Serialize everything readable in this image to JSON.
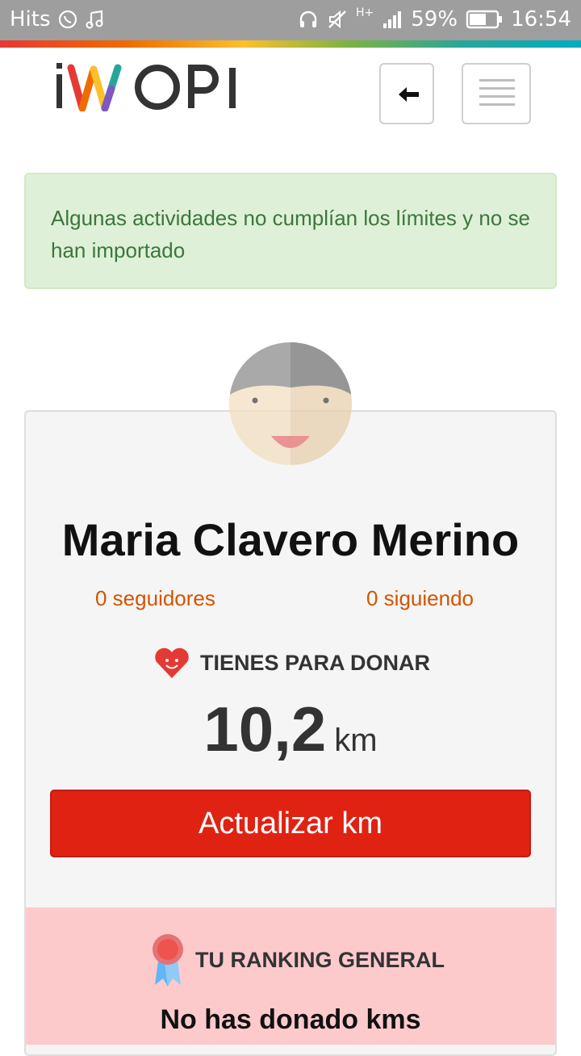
{
  "status_bar": {
    "carrier": "Hits",
    "battery": "59%",
    "time": "16:54",
    "network": "H+",
    "icons": [
      "whatsapp-icon",
      "music-icon",
      "headphones-icon",
      "mute-icon",
      "signal-icon",
      "battery-icon"
    ]
  },
  "header": {
    "logo_text": "iWOPI",
    "back_icon": "arrow-left-icon",
    "menu_icon": "hamburger-icon"
  },
  "alert": {
    "message": "Algunas actividades no cumplían los límites y no se han importado"
  },
  "profile": {
    "name": "Maria Clavero Merino",
    "followers": "0 seguidores",
    "following": "0 siguiendo"
  },
  "donate": {
    "label": "TIENES PARA DONAR",
    "value": "10,2",
    "unit": "km",
    "icon": "heart-icon"
  },
  "actions": {
    "update_label": "Actualizar km"
  },
  "ranking": {
    "label": "TU RANKING GENERAL",
    "message": "No has donado kms",
    "icon": "medal-icon"
  },
  "colors": {
    "accent_red": "#e02212",
    "link_orange": "#d35400",
    "alert_green": "#3c763d",
    "ranking_bg": "#fdcacb"
  }
}
